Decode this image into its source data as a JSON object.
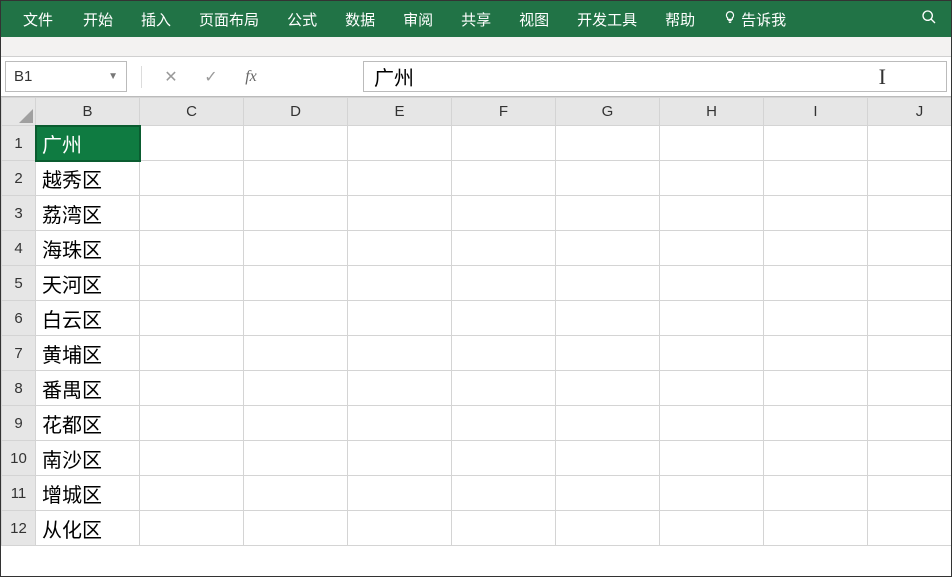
{
  "ribbon": {
    "tabs": [
      "文件",
      "开始",
      "插入",
      "页面布局",
      "公式",
      "数据",
      "审阅",
      "共享",
      "视图",
      "开发工具",
      "帮助"
    ],
    "tell_me": "告诉我"
  },
  "name_box": {
    "value": "B1"
  },
  "fx": {
    "cancel": "✕",
    "confirm": "✓",
    "label": "fx"
  },
  "formula_bar": {
    "value": "广州"
  },
  "columns": [
    "B",
    "C",
    "D",
    "E",
    "F",
    "G",
    "H",
    "I",
    "J"
  ],
  "rows": [
    {
      "n": 1,
      "B": "广州"
    },
    {
      "n": 2,
      "B": "越秀区"
    },
    {
      "n": 3,
      "B": "荔湾区"
    },
    {
      "n": 4,
      "B": "海珠区"
    },
    {
      "n": 5,
      "B": "天河区"
    },
    {
      "n": 6,
      "B": "白云区"
    },
    {
      "n": 7,
      "B": "黄埔区"
    },
    {
      "n": 8,
      "B": "番禺区"
    },
    {
      "n": 9,
      "B": "花都区"
    },
    {
      "n": 10,
      "B": "南沙区"
    },
    {
      "n": 11,
      "B": "增城区"
    },
    {
      "n": 12,
      "B": "从化区"
    }
  ],
  "selected_cell": "B1"
}
